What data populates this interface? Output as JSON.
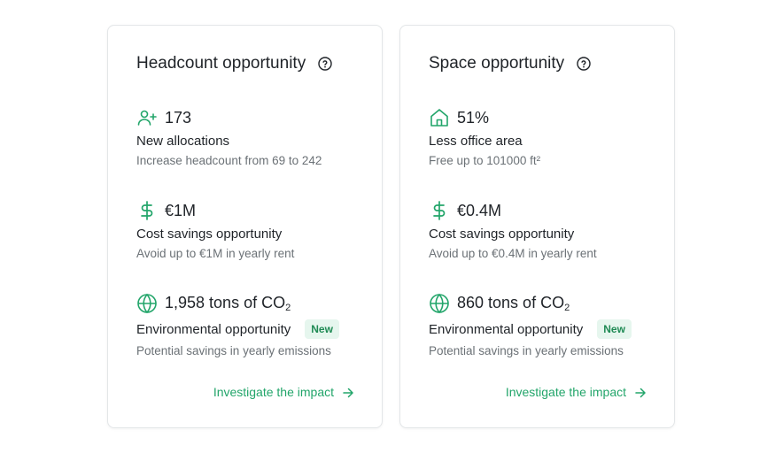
{
  "cards": [
    {
      "title": "Headcount opportunity",
      "metrics": [
        {
          "value": "173",
          "label": "New allocations",
          "desc": "Increase headcount from 69 to 242"
        },
        {
          "value": "€1M",
          "label": "Cost savings opportunity",
          "desc": "Avoid up to €1M in yearly rent"
        },
        {
          "value": "1,958 tons of CO",
          "value_sub": "2",
          "label": "Environmental opportunity",
          "badge": "New",
          "desc": "Potential savings in yearly emissions"
        }
      ],
      "cta": "Investigate the impact"
    },
    {
      "title": "Space opportunity",
      "metrics": [
        {
          "value": "51%",
          "label": "Less office area",
          "desc": "Free up to 101000 ft²"
        },
        {
          "value": "€0.4M",
          "label": "Cost savings opportunity",
          "desc": "Avoid up to €0.4M in yearly rent"
        },
        {
          "value": "860 tons of CO",
          "value_sub": "2",
          "label": "Environmental opportunity",
          "badge": "New",
          "desc": "Potential savings in yearly emissions"
        }
      ],
      "cta": "Investigate the impact"
    }
  ],
  "colors": {
    "accent": "#22a56a",
    "badge_bg": "#e6f6ee",
    "muted_text": "#6b7176"
  },
  "icons": [
    "help-circle-icon",
    "user-plus-icon",
    "home-icon",
    "dollar-icon",
    "globe-icon",
    "arrow-right-icon"
  ]
}
